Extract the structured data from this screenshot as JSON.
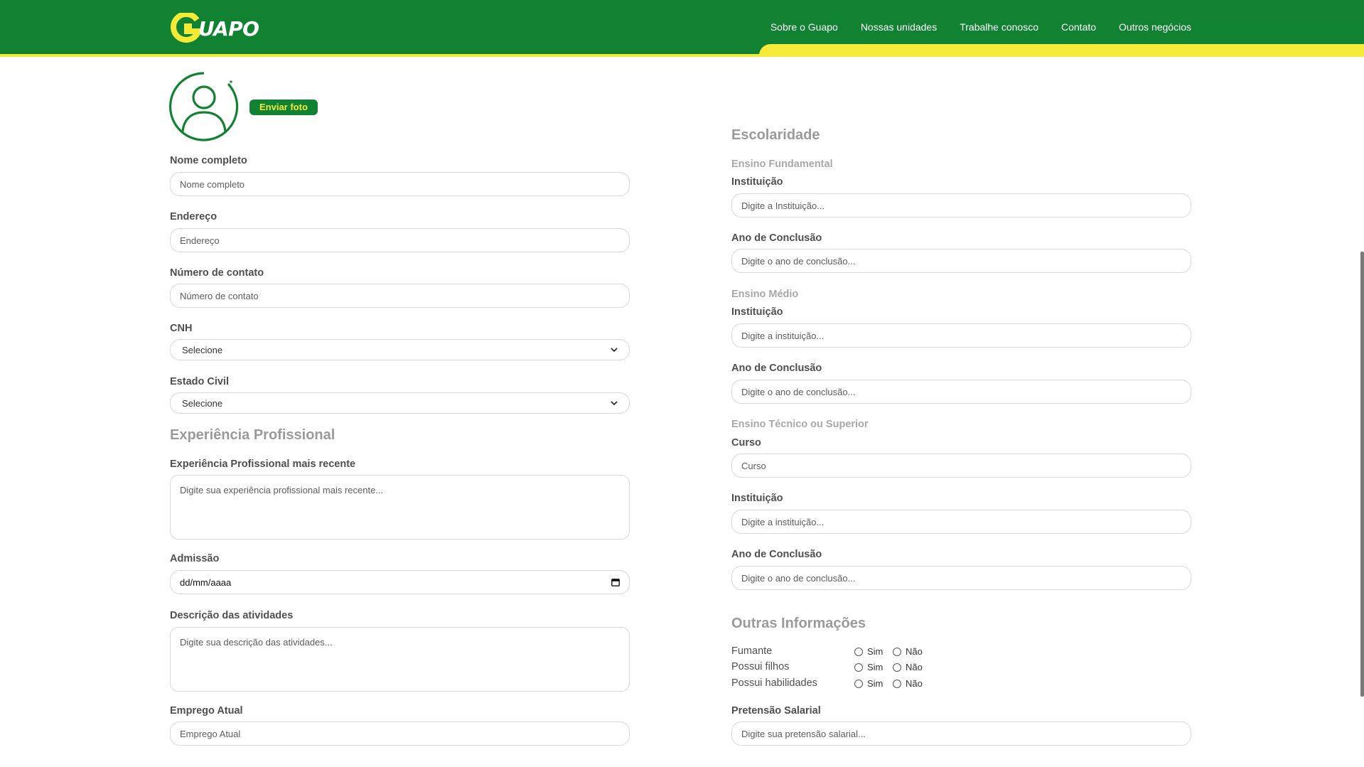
{
  "header": {
    "logo_text": "UAPO",
    "nav": [
      "Sobre o Guapo",
      "Nossas unidades",
      "Trabalhe conosco",
      "Contato",
      "Outros negócios"
    ]
  },
  "photo": {
    "button_label": "Enviar foto"
  },
  "personal": {
    "nome": {
      "label": "Nome completo",
      "placeholder": "Nome completo"
    },
    "endereco": {
      "label": "Endereço",
      "placeholder": "Endereço"
    },
    "contato": {
      "label": "Número de contato",
      "placeholder": "Número de contato"
    },
    "cnh": {
      "label": "CNH",
      "value": "Selecione"
    },
    "estado_civil": {
      "label": "Estado Civil",
      "value": "Selecione"
    }
  },
  "experience": {
    "title": "Experiência Profissional",
    "recente": {
      "label": "Experiência Profissional mais recente",
      "placeholder": "Digite sua experiência profissional mais recente..."
    },
    "admissao": {
      "label": "Admissão",
      "value": "dd/mm/aaaa"
    },
    "descricao": {
      "label": "Descrição das atividades",
      "placeholder": "Digite sua descrição das atividades..."
    },
    "emprego": {
      "label": "Emprego Atual",
      "placeholder": "Emprego Atual"
    }
  },
  "education": {
    "title": "Escolaridade",
    "fundamental": {
      "title": "Ensino Fundamental",
      "instituicao": {
        "label": "Instituição",
        "placeholder": "Digite a Instituição..."
      },
      "ano": {
        "label": "Ano de Conclusão",
        "placeholder": "Digite o ano de conclusão..."
      }
    },
    "medio": {
      "title": "Ensino Médio",
      "instituicao": {
        "label": "Instituição",
        "placeholder": "Digite a instituição..."
      },
      "ano": {
        "label": "Ano de Conclusão",
        "placeholder": "Digite o ano de conclusão..."
      }
    },
    "tecnico": {
      "title": "Ensino Técnico ou Superior",
      "curso": {
        "label": "Curso",
        "placeholder": "Curso"
      },
      "instituicao": {
        "label": "Instituição",
        "placeholder": "Digite a instituição..."
      },
      "ano": {
        "label": "Ano de Conclusão",
        "placeholder": "Digite o ano de conclusão..."
      }
    }
  },
  "other": {
    "title": "Outras Informações",
    "questions": [
      {
        "label": "Fumante",
        "yes": "Sim",
        "no": "Não"
      },
      {
        "label": "Possui filhos",
        "yes": "Sim",
        "no": "Não"
      },
      {
        "label": "Possui habilidades",
        "yes": "Sim",
        "no": "Não"
      }
    ],
    "salario": {
      "label": "Pretensão Salarial",
      "placeholder": "Digite sua pretensão salarial..."
    }
  },
  "colors": {
    "brand_green": "#118232",
    "brand_yellow": "#f7ea3a"
  }
}
